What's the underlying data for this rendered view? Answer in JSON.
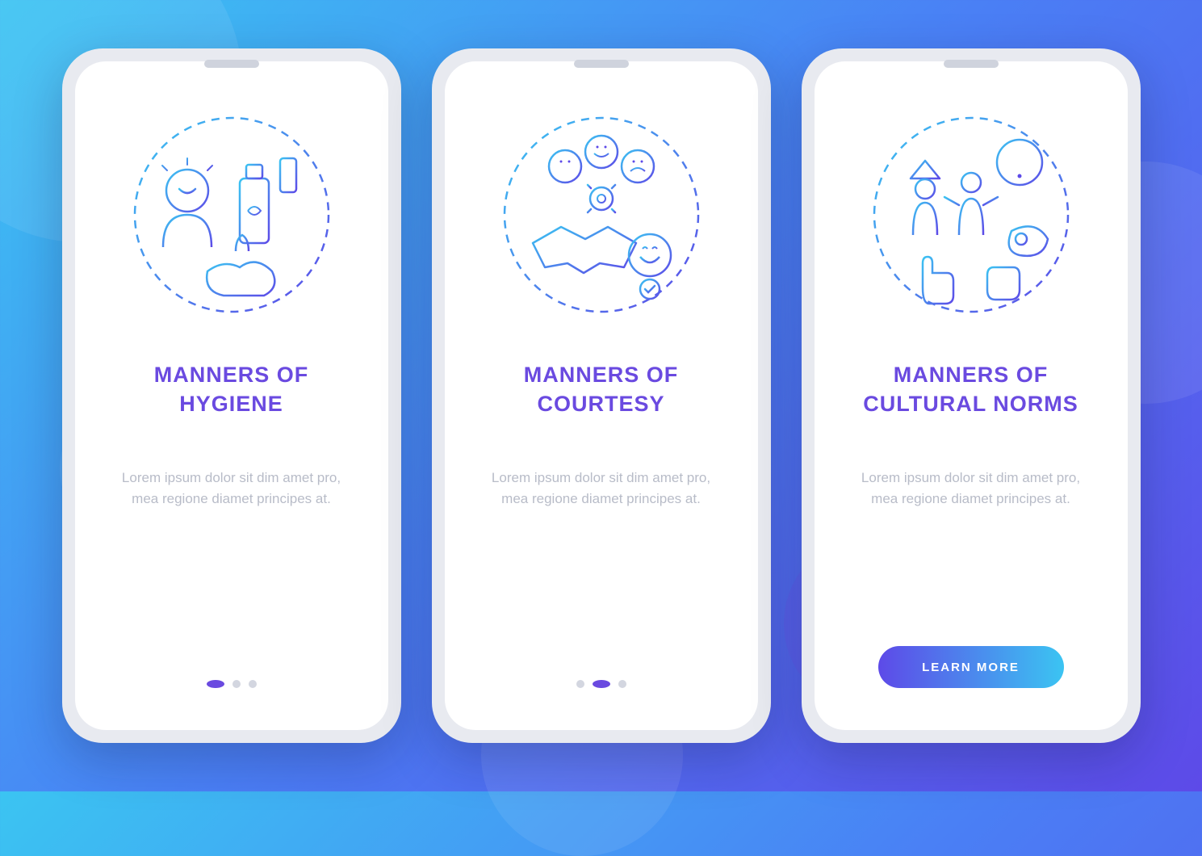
{
  "colors": {
    "accent": "#6a4ae0",
    "gradient_start": "#3bc4f2",
    "gradient_end": "#5d4ae8",
    "placeholder_text": "#b8bcc8"
  },
  "cta_label": "LEARN MORE",
  "placeholder_body": "Lorem ipsum dolor sit dim amet pro, mea regione diamet principes at.",
  "screens": [
    {
      "id": "hygiene",
      "title": "MANNERS OF HYGIENE",
      "icon": "hygiene-icon",
      "active_dot": 0,
      "show_cta": false
    },
    {
      "id": "courtesy",
      "title": "MANNERS OF COURTESY",
      "icon": "courtesy-icon",
      "active_dot": 1,
      "show_cta": false
    },
    {
      "id": "cultural",
      "title": "MANNERS OF CULTURAL NORMS",
      "icon": "cultural-icon",
      "active_dot": 2,
      "show_cta": true
    }
  ]
}
